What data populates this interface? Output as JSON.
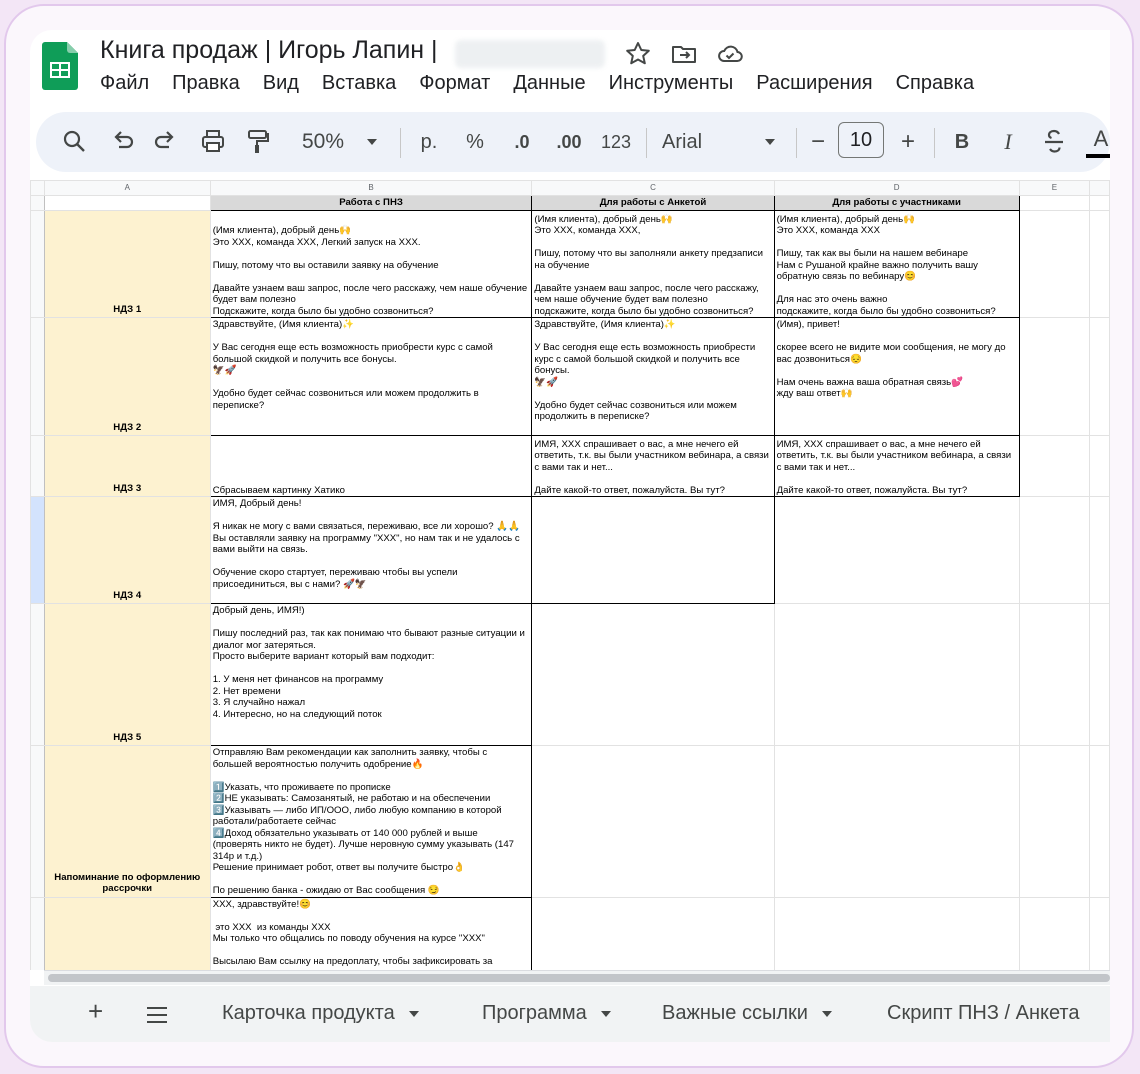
{
  "app": {
    "title": "Книга продаж | Игорь Лапин |",
    "colors": {
      "sheets_green": "#0f9d58",
      "label_fill": "#fdf2d0",
      "header_fill": "#d9d9d9",
      "row_select": "#d3e3fd"
    }
  },
  "header_icons": [
    "star-icon",
    "move-to-folder-icon",
    "cloud-saved-icon"
  ],
  "menu": [
    "Файл",
    "Правка",
    "Вид",
    "Вставка",
    "Формат",
    "Данные",
    "Инструменты",
    "Расширения",
    "Справка"
  ],
  "toolbar": {
    "zoom": "50%",
    "currency": "р.",
    "percent": "%",
    "dec_decrease": ".0",
    "dec_increase": ".00",
    "number_format": "123",
    "font": "Arial",
    "font_size": "10",
    "minus": "−",
    "plus": "+",
    "bold": "B",
    "italic": "I",
    "text_color": "A",
    "icons": [
      "search-icon",
      "undo-icon",
      "redo-icon",
      "print-icon",
      "paint-format-icon",
      "strikethrough-icon"
    ]
  },
  "columns": [
    "A",
    "B",
    "C",
    "D",
    "E"
  ],
  "sheet": {
    "headers": [
      "Работа с ПНЗ",
      "Для работы с Анкетой",
      "Для работы с участниками"
    ],
    "rows": [
      {
        "label": "НДЗ 1",
        "b": "(Имя клиента), добрый день🙌\nЭто XXX, команда XXX, Легкий запуск на XXX.\n\nПишу, потому что вы оставили заявку на обучение\n\nДавайте узнаем ваш запрос, после чего расскажу, чем наше обучение будет вам полезно\nПодскажите, когда было бы удобно созвониться?",
        "c": "(Имя клиента), добрый день🙌\nЭто XXX, команда XXX,\n\nПишу, потому что вы заполняли анкету предзаписи на обучение\n\nДавайте узнаем ваш запрос, после чего расскажу, чем наше обучение будет вам полезно\nподскажите, когда было бы удобно созвониться?",
        "d": "(Имя клиента), добрый день🙌\nЭто XXX, команда XXX\n\nПишу, так как вы были на нашем вебинаре\nНам с Рушаной крайне важно получить вашу обратную связь по вебинару😊\n\nДля нас это очень важно\nподскажите, когда было бы удобно созвониться?"
      },
      {
        "label": "НДЗ 2",
        "b": "Здравствуйте, (Имя клиента)✨\n\nУ Вас сегодня еще есть возможность приобрести курс с самой большой скидкой и получить все бонусы.\n🦅🚀\n\nУдобно будет сейчас созвониться или можем продолжить в переписке?",
        "c": "Здравствуйте, (Имя клиента)✨\n\nУ Вас сегодня еще есть возможность приобрести курс с самой большой скидкой и получить все бонусы.\n🦅🚀\n\nУдобно будет сейчас созвониться или можем продолжить в переписке?",
        "d": "(Имя), привет!\n\nскорее всего не видите мои сообщения, не могу до вас дозвониться😔\n\nНам очень важна ваша обратная связь💕\nжду ваш ответ🙌"
      },
      {
        "label": "НДЗ 3",
        "b": "Сбрасываем картинку Хатико",
        "c": "ИМЯ, XXX спрашивает о вас, а мне нечего ей ответить, т.к. вы были участником вебинара, а связи с вами так и нет...\n\nДайте какой-то ответ, пожалуйста. Вы тут?",
        "d": "ИМЯ, XXX спрашивает о вас, а мне нечего ей ответить, т.к. вы были участником вебинара, а связи с вами так и нет...\n\nДайте какой-то ответ, пожалуйста. Вы тут?"
      },
      {
        "label": "НДЗ 4",
        "b": "ИМЯ, Добрый день!\n\nЯ никак не могу с вами связаться, переживаю, все ли хорошо? 🙏🙏\nВы оставляли заявку на программу \"XXX\", но нам так и не удалось с вами выйти на связь.\n\nОбучение скоро стартует, переживаю чтобы вы успели присоединиться, вы с нами? 🚀🦅",
        "c": "",
        "d": ""
      },
      {
        "label": "НДЗ 5",
        "b": "Добрый день, ИМЯ!)\n\nПишу последний раз, так как понимаю что бывают разные ситуации и диалог мог затеряться.\nПросто выберите вариант который вам подходит:\n\n1. У меня нет финансов на программу\n2. Нет времени\n3. Я случайно нажал\n4. Интересно, но на следующий поток",
        "c": "",
        "d": ""
      },
      {
        "label": "Напоминание по оформлению рассрочки",
        "b": "Отправляю Вам рекомендации как заполнить заявку, чтобы с большей вероятностью получить одобрение🔥\n\n1️⃣Указать, что проживаете по прописке\n2️⃣НЕ указывать: Самозанятый, не работаю и на обеспечении\n3️⃣Указывать — либо ИП/ООО, либо любую компанию в которой работали/работаете сейчас\n4️⃣Доход обязательно указывать от 140 000 рублей и выше (проверять никто не будет). Лучше неровную сумму указывать (147 314р и т.д.)\nРешение принимает робот, ответ вы получите быстро👌\n\nПо решению банка - ожидаю от Вас сообщения 😏",
        "c": "",
        "d": ""
      },
      {
        "label": "",
        "b": "XXX, здравствуйте!😊\n\n это XXX  из команды XXX\nМы только что общались по поводу обучения на курсе \"XXX\"\n\nВысылаю Вам ссылку на предоплату, чтобы зафиксировать за",
        "c": "",
        "d": ""
      }
    ]
  },
  "bottom": {
    "add_sheet": "+",
    "all_sheets": "≡",
    "tabs": [
      "Карточка продукта",
      "Программа",
      "Важные ссылки",
      "Скрипт ПНЗ / Анкета"
    ]
  }
}
